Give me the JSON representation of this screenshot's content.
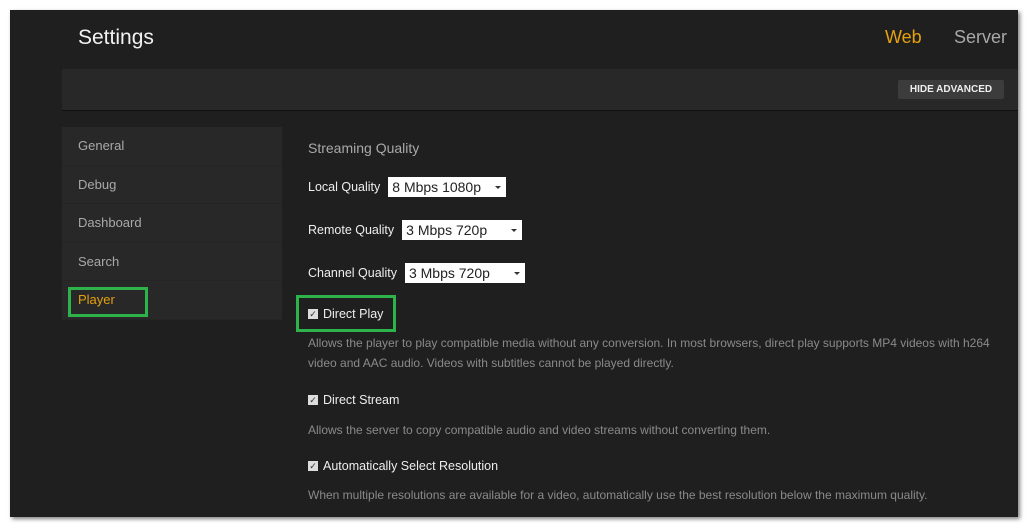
{
  "header": {
    "title": "Settings",
    "nav": [
      {
        "label": "Web",
        "active": true
      },
      {
        "label": "Server",
        "active": false
      }
    ],
    "hide_advanced": "HIDE ADVANCED"
  },
  "sidebar": {
    "items": [
      {
        "label": "General"
      },
      {
        "label": "Debug"
      },
      {
        "label": "Dashboard"
      },
      {
        "label": "Search"
      },
      {
        "label": "Player",
        "active": true
      }
    ]
  },
  "main": {
    "section_title": "Streaming Quality",
    "local_quality": {
      "label": "Local Quality",
      "value": "8 Mbps 1080p"
    },
    "remote_quality": {
      "label": "Remote Quality",
      "value": "3 Mbps 720p"
    },
    "channel_quality": {
      "label": "Channel Quality",
      "value": "3 Mbps 720p"
    },
    "direct_play": {
      "label": "Direct Play",
      "checked": true,
      "desc": "Allows the player to play compatible media without any conversion. In most browsers, direct play supports MP4 videos with h264 video and AAC audio. Videos with subtitles cannot be played directly."
    },
    "direct_stream": {
      "label": "Direct Stream",
      "checked": true,
      "desc": "Allows the server to copy compatible audio and video streams without converting them."
    },
    "auto_resolution": {
      "label": "Automatically Select Resolution",
      "checked": true,
      "desc": "When multiple resolutions are available for a video, automatically use the best resolution below the maximum quality."
    }
  },
  "colors": {
    "accent": "#e5a00d",
    "highlight": "#2db34a",
    "background": "#1f1f1f"
  }
}
